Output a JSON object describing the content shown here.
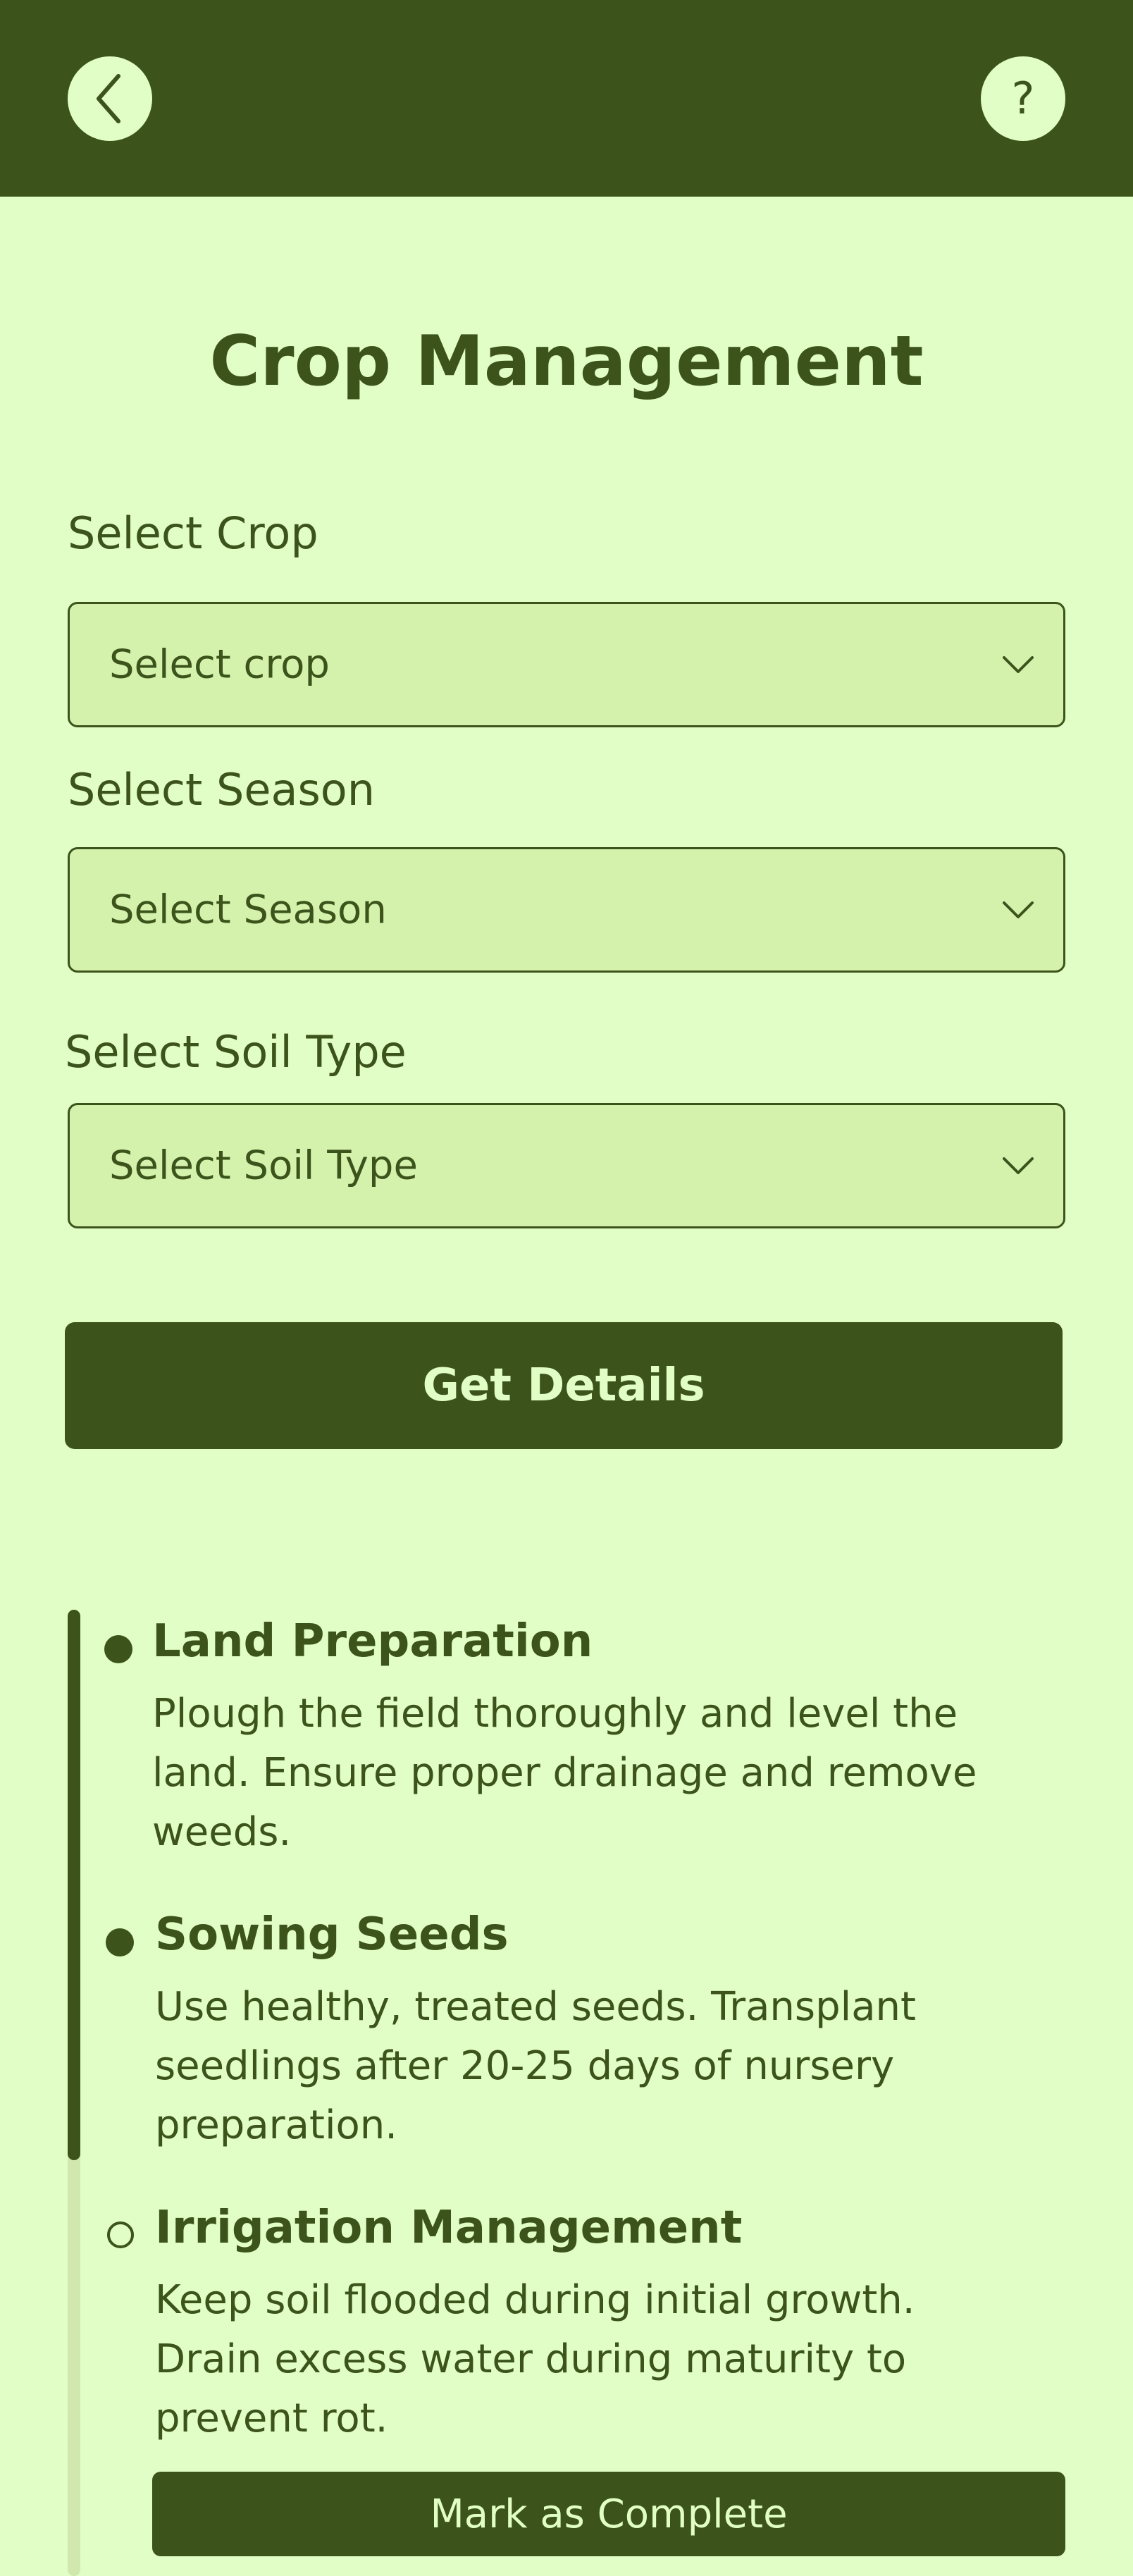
{
  "header": {
    "back_icon": "chevron-left-icon",
    "help_label": "?"
  },
  "page": {
    "title": "Crop Management"
  },
  "form": {
    "crop": {
      "label": "Select Crop",
      "value": "Select crop"
    },
    "season": {
      "label": "Select Season",
      "value": "Select Season"
    },
    "soil": {
      "label": "Select Soil Type",
      "value": "Select Soil Type"
    },
    "submit_label": "Get Details"
  },
  "timeline": {
    "progress_fraction": 0.57,
    "steps": [
      {
        "title": "Land Preparation",
        "status": "complete",
        "lines": [
          "Plough the field thoroughly and level the",
          "land. Ensure proper drainage and remove",
          "weeds."
        ]
      },
      {
        "title": "Sowing Seeds",
        "status": "complete",
        "lines": [
          "Use healthy, treated seeds. Transplant",
          "seedlings after 20-25 days of nursery",
          "preparation."
        ]
      },
      {
        "title": "Irrigation Management",
        "status": "pending",
        "lines": [
          "Keep soil flooded during initial growth.",
          "Drain excess water during maturity to",
          "prevent rot."
        ],
        "action_label": "Mark as Complete"
      }
    ]
  },
  "colors": {
    "primary": "#3c541b",
    "background": "#e1fec6",
    "field_bg": "#d5f2ad",
    "rail_track": "#d0e8ad"
  }
}
